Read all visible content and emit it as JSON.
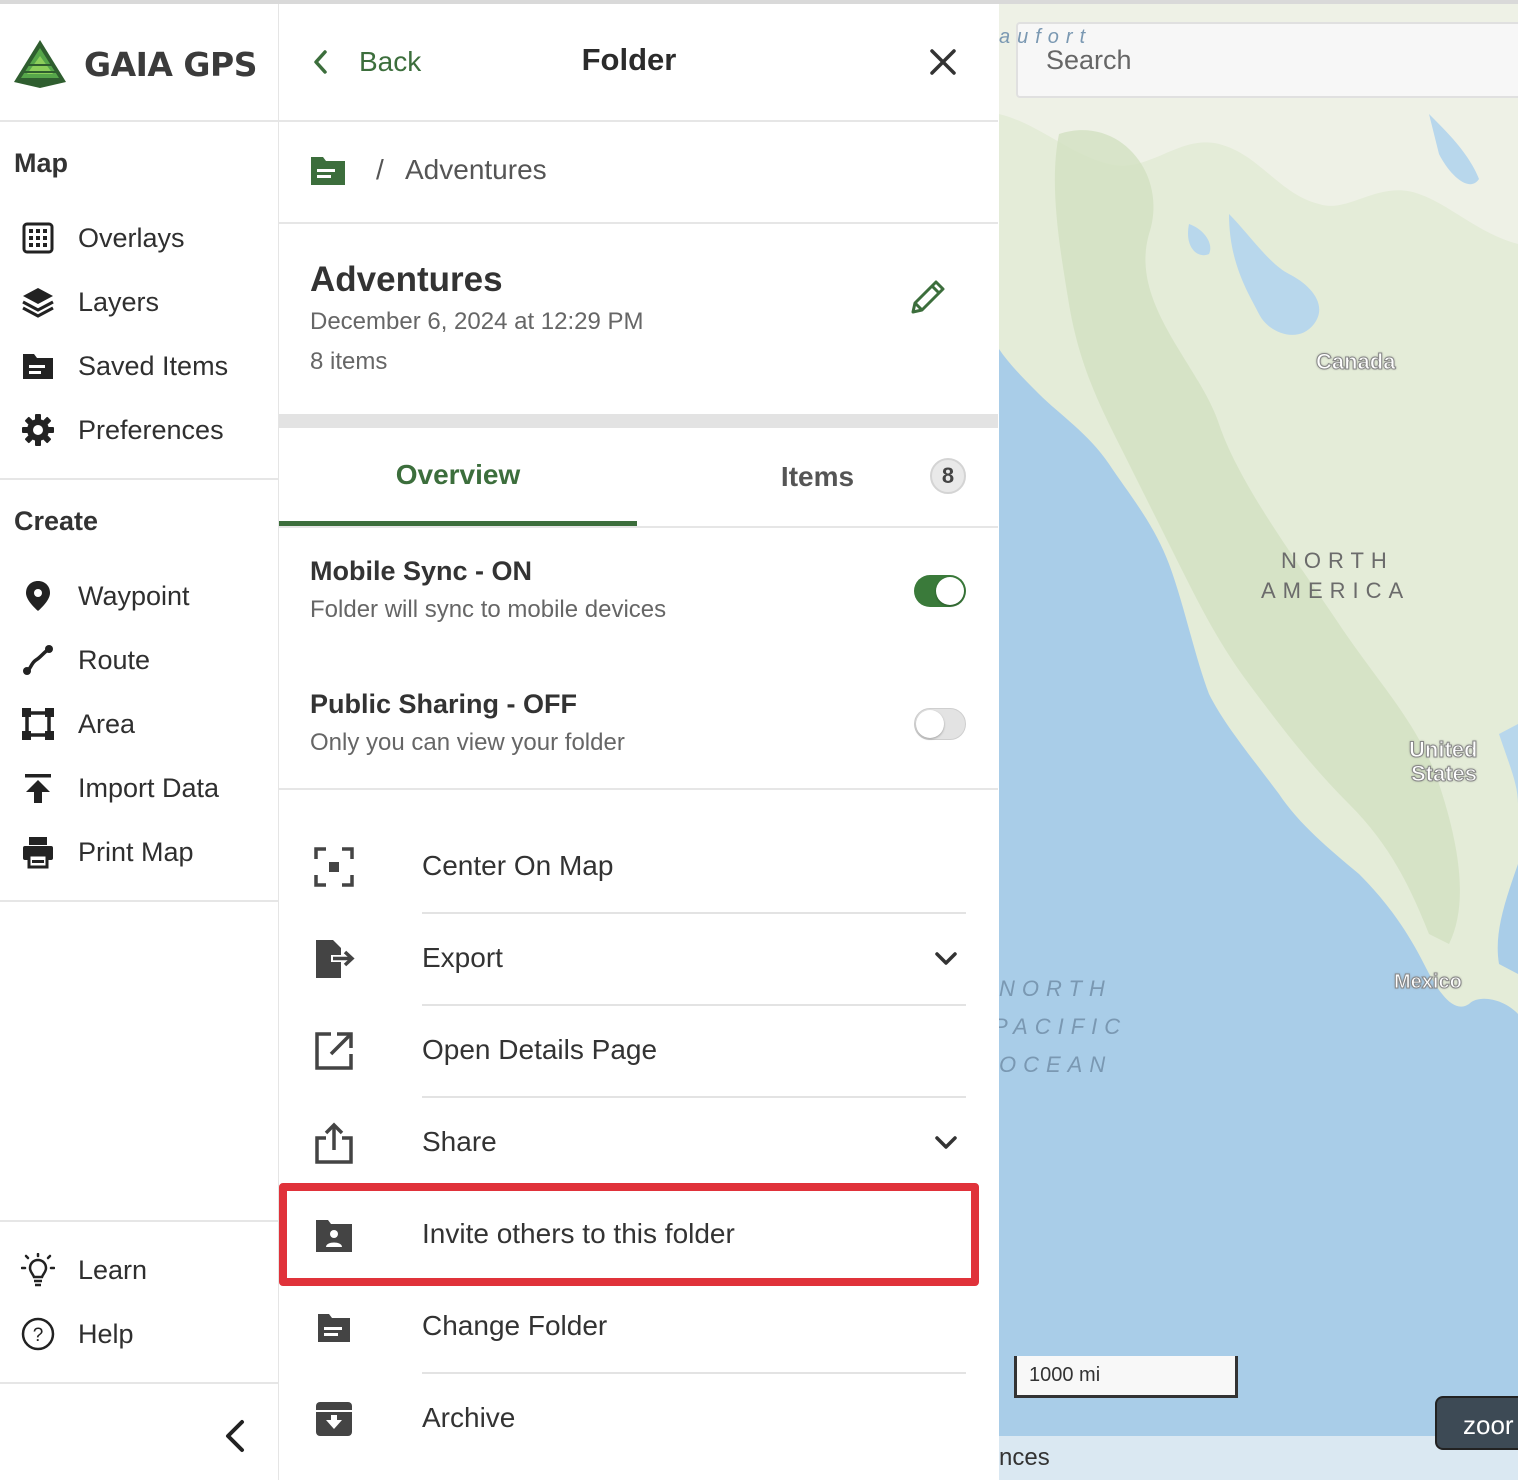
{
  "brand": {
    "name": "GAIA GPS",
    "accent": "#3c6e3c",
    "logo_colors": [
      "#2f5e2f",
      "#56a64a",
      "#8ccf5a"
    ]
  },
  "sidebar": {
    "map_heading": "Map",
    "map_items": [
      {
        "label": "Overlays",
        "icon": "grid-icon"
      },
      {
        "label": "Layers",
        "icon": "layers-icon"
      },
      {
        "label": "Saved Items",
        "icon": "folder-icon"
      },
      {
        "label": "Preferences",
        "icon": "gear-icon"
      }
    ],
    "create_heading": "Create",
    "create_items": [
      {
        "label": "Waypoint",
        "icon": "pin-icon"
      },
      {
        "label": "Route",
        "icon": "route-icon"
      },
      {
        "label": "Area",
        "icon": "area-icon"
      },
      {
        "label": "Import Data",
        "icon": "upload-icon"
      },
      {
        "label": "Print Map",
        "icon": "printer-icon"
      }
    ],
    "bottom_items": [
      {
        "label": "Learn",
        "icon": "lightbulb-icon"
      },
      {
        "label": "Help",
        "icon": "help-icon"
      }
    ]
  },
  "panel": {
    "back_label": "Back",
    "title": "Folder",
    "breadcrumb": {
      "separator": "/",
      "current": "Adventures"
    },
    "folder": {
      "name": "Adventures",
      "date": "December 6, 2024 at 12:29 PM",
      "count": "8 items"
    },
    "tabs": [
      {
        "label": "Overview",
        "active": true
      },
      {
        "label": "Items",
        "badge": "8"
      }
    ],
    "mobile_sync": {
      "title": "Mobile Sync - ON",
      "subtitle": "Folder will sync to mobile devices",
      "on": true
    },
    "public_sharing": {
      "title": "Public Sharing - OFF",
      "subtitle": "Only you can view your folder",
      "on": false
    },
    "actions": [
      {
        "label": "Center On Map",
        "icon": "center-focus-icon"
      },
      {
        "label": "Export",
        "icon": "export-icon",
        "expandable": true
      },
      {
        "label": "Open Details Page",
        "icon": "open-external-icon"
      },
      {
        "label": "Share",
        "icon": "share-icon",
        "expandable": true
      },
      {
        "label": "Invite others to this folder",
        "icon": "folder-shared-icon",
        "highlighted": true,
        "highlight_color": "#e0323a"
      },
      {
        "label": "Change Folder",
        "icon": "folder-icon"
      },
      {
        "label": "Archive",
        "icon": "archive-icon"
      }
    ]
  },
  "map": {
    "search_placeholder": "Search",
    "labels": {
      "canada": "Canada",
      "north_america": [
        "NORTH",
        "AMERICA"
      ],
      "united_states": [
        "United",
        "States"
      ],
      "mexico": "Mexico",
      "ocean": [
        "NORTH",
        "PACIFIC",
        "OCEAN"
      ],
      "beaufort": "aufort"
    },
    "scale": "1000 mi",
    "zoom_label": "zoor",
    "attribution": "nces"
  }
}
